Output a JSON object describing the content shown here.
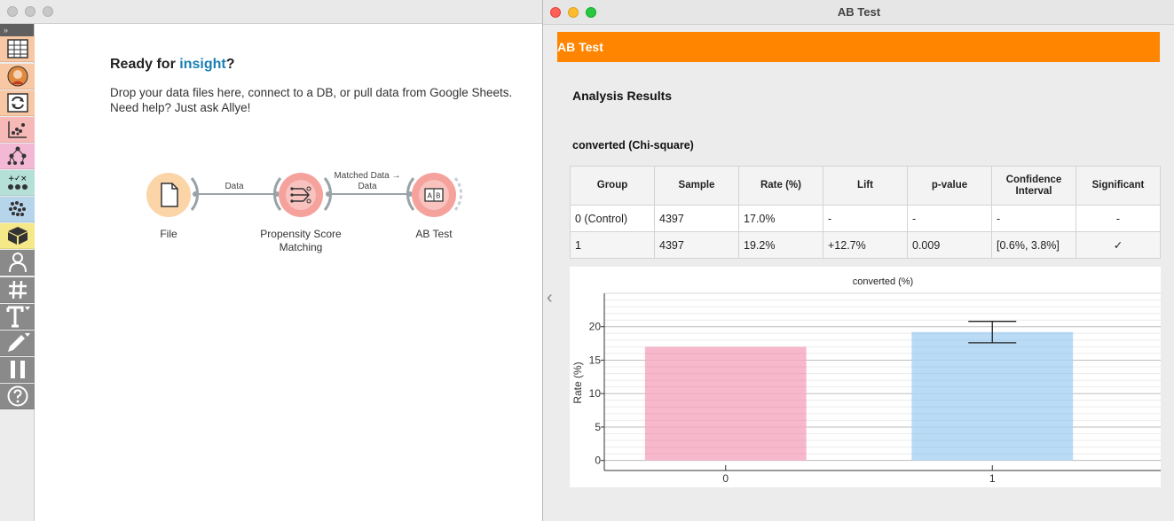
{
  "main_window": {
    "toolbox_toggle": "»",
    "welcome": {
      "title_prefix": "Ready for ",
      "title_highlight": "insight",
      "title_suffix": "?",
      "line1": "Drop your data files here, connect to a DB, or pull data from Google Sheets.",
      "line2": "Need help? Just ask Allye!"
    },
    "workflow": {
      "nodes": [
        {
          "label": "File"
        },
        {
          "label_line1": "Propensity Score",
          "label_line2": "Matching"
        },
        {
          "label": "AB Test"
        }
      ],
      "links": [
        {
          "label": "Data"
        },
        {
          "label_line1": "Matched Data →",
          "label_line2": "Data"
        }
      ]
    },
    "toolbox_icons": [
      "table-icon",
      "avatar-icon",
      "transform-icon",
      "scatter-icon",
      "tree-icon",
      "grid-icon",
      "cluster-icon",
      "box-icon",
      "person-icon",
      "hash-icon",
      "text-icon",
      "pen-icon",
      "pause-icon",
      "help-icon"
    ]
  },
  "ab_window": {
    "title": "AB Test",
    "header": "AB Test",
    "section_title": "Analysis Results",
    "metric_title": "converted (Chi-square)",
    "table": {
      "headers": [
        "Group",
        "Sample",
        "Rate (%)",
        "Lift",
        "p-value",
        "Confidence Interval",
        "Significant"
      ],
      "rows": [
        [
          "0 (Control)",
          "4397",
          "17.0%",
          "-",
          "-",
          "-",
          "-"
        ],
        [
          "1",
          "4397",
          "19.2%",
          "+12.7%",
          "0.009",
          "[0.6%, 3.8%]",
          "✓"
        ]
      ]
    },
    "collapse_icon": "‹"
  },
  "chart_data": {
    "type": "bar",
    "title": "converted (%)",
    "categories": [
      "0",
      "1"
    ],
    "values": [
      17.0,
      19.2
    ],
    "error": [
      [
        null,
        null
      ],
      [
        17.6,
        20.8
      ]
    ],
    "colors": [
      "#f7b8cc",
      "#b9dbf6"
    ],
    "ylabel": "Rate (%)",
    "xlabel": "",
    "ylim": [
      -1.5,
      25
    ],
    "yticks": [
      0,
      5,
      10,
      15,
      20
    ],
    "grid": true
  }
}
